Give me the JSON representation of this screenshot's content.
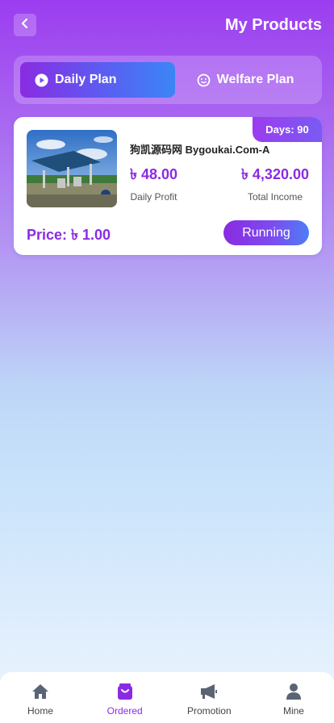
{
  "header": {
    "title": "My Products"
  },
  "tabs": [
    {
      "label": "Daily Plan",
      "active": true
    },
    {
      "label": "Welfare Plan",
      "active": false
    }
  ],
  "product": {
    "days_badge": "Days: 90",
    "name": "狗凯源码网 Bygoukai.Com-A",
    "daily_profit_value": "৳ 48.00",
    "daily_profit_label": "Daily Profit",
    "total_income_value": "৳ 4,320.00",
    "total_income_label": "Total Income",
    "price": "Price: ৳ 1.00",
    "status": "Running"
  },
  "bottom_nav": [
    {
      "label": "Home",
      "icon": "home-icon",
      "active": false
    },
    {
      "label": "Ordered",
      "icon": "bag-icon",
      "active": true
    },
    {
      "label": "Promotion",
      "icon": "megaphone-icon",
      "active": false
    },
    {
      "label": "Mine",
      "icon": "user-icon",
      "active": false
    }
  ],
  "colors": {
    "accent": "#8a2be2",
    "accent_blue": "#3a86f6"
  }
}
